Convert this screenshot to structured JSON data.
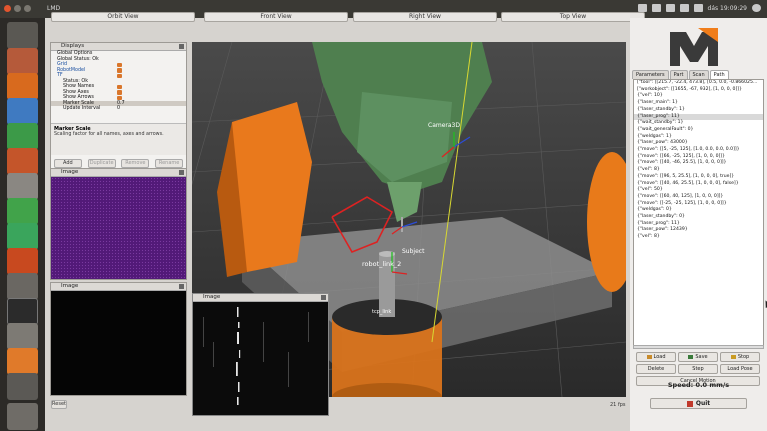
{
  "window": {
    "title": "LMD",
    "clock": "dás 19:09:29"
  },
  "colors": {
    "accent": "#f07d1a",
    "launcher": "#2c2a27",
    "selection": "#d9762b"
  },
  "launcher": {
    "icons": [
      "dash-icon",
      "files-icon",
      "firefox-icon",
      "writer-icon",
      "calc-icon",
      "impress-icon",
      "settings-icon",
      "qt-icon",
      "browser-icon",
      "software-icon",
      "tools-icon",
      "terminal-icon",
      "text-editor-icon",
      "presenter-icon",
      "video-icon",
      "trash-icon"
    ]
  },
  "views": [
    "Orbit View",
    "Front View",
    "Right View",
    "Top View"
  ],
  "displays": {
    "title": "Displays",
    "tree": [
      {
        "label": "Global Options",
        "level": 1
      },
      {
        "label": "Global Status: Ok",
        "level": 1
      },
      {
        "label": "Grid",
        "level": 1
      },
      {
        "label": "RobotModel",
        "level": 1
      },
      {
        "label": "TF",
        "level": 1
      },
      {
        "label": "Status: Ok",
        "level": 2
      },
      {
        "label": "Show Names",
        "level": 2
      },
      {
        "label": "Show Axes",
        "level": 2
      },
      {
        "label": "Show Arrows",
        "level": 2
      },
      {
        "label": "Marker Scale",
        "level": 2,
        "value": "0.7"
      },
      {
        "label": "Update Interval",
        "level": 2,
        "value": "0"
      }
    ],
    "desc_title": "Marker Scale",
    "desc_text": "Scaling factor for all names, axes and arrows.",
    "buttons": {
      "add": "Add",
      "duplicate": "Duplicate",
      "remove": "Remove",
      "rename": "Rename"
    }
  },
  "image_panels": {
    "top": "Image",
    "bottom": "Image",
    "float": "Image"
  },
  "reset": "Reset",
  "fps": "21 fps",
  "viewport_labels": {
    "camera": "Camera3D",
    "link": "robot_link_2",
    "subject": "Subject",
    "tcp": "tcp_link"
  },
  "right": {
    "tabs": [
      "Parameters",
      "Part",
      "Scan",
      "Path"
    ],
    "active_tab": "Path",
    "code": [
      "[\"tool\": [[215.7, -22.4, 473.8], [0.5, 0.0, -0.866025...",
      "[\"workobject\": [[1655, -67, 932], [1, 0, 0, 0]]}",
      "{\"vel\": 10}",
      "{\"laser_main\": 1}",
      "{\"laser_standby\": 1}",
      "{\"laser_prog\": 11}",
      "{\"wait_standby\": 1}",
      "{\"wait_generalFault\": 0}",
      "{\"weldgas\": 1}",
      "{\"laser_pow\": 43000}",
      "{\"move\": [[5, -25, 125], [1.0, 0.0, 0.0, 0.0]]}",
      "{\"move\": [[66, -25, 125], [1, 0, 0, 0]]}",
      "{\"move\": [[40, -46, 25.5], [1, 0, 0, 0]]}",
      "{\"vel\": 8}",
      "{\"move\": [[96, 5, 25.5], [1, 0, 0, 0], true]}",
      "{\"move\": [[40, 46, 25.5], [1, 0, 0, 0], false]}",
      "{\"vel\": 50}",
      "{\"move\": [[60, 40, 125], [1, 0, 0, 0]]}",
      "{\"move\": [[-25, -25, 125], [1, 0, 0, 0]]}",
      "{\"weldgas\": 0}",
      "{\"laser_standby\": 0}",
      "{\"laser_prog\": 11}",
      "{\"laser_pow\": 12439}",
      "{\"vel\": 8}"
    ],
    "buttons": {
      "load": "Load",
      "save": "Save",
      "stop": "Stop",
      "delete": "Delete",
      "step": "Step",
      "load_pose": "Load Pose",
      "cancel": "Cancel Motion"
    },
    "speed": "Speed: 0.0 mm/s",
    "quit": "Quit"
  }
}
